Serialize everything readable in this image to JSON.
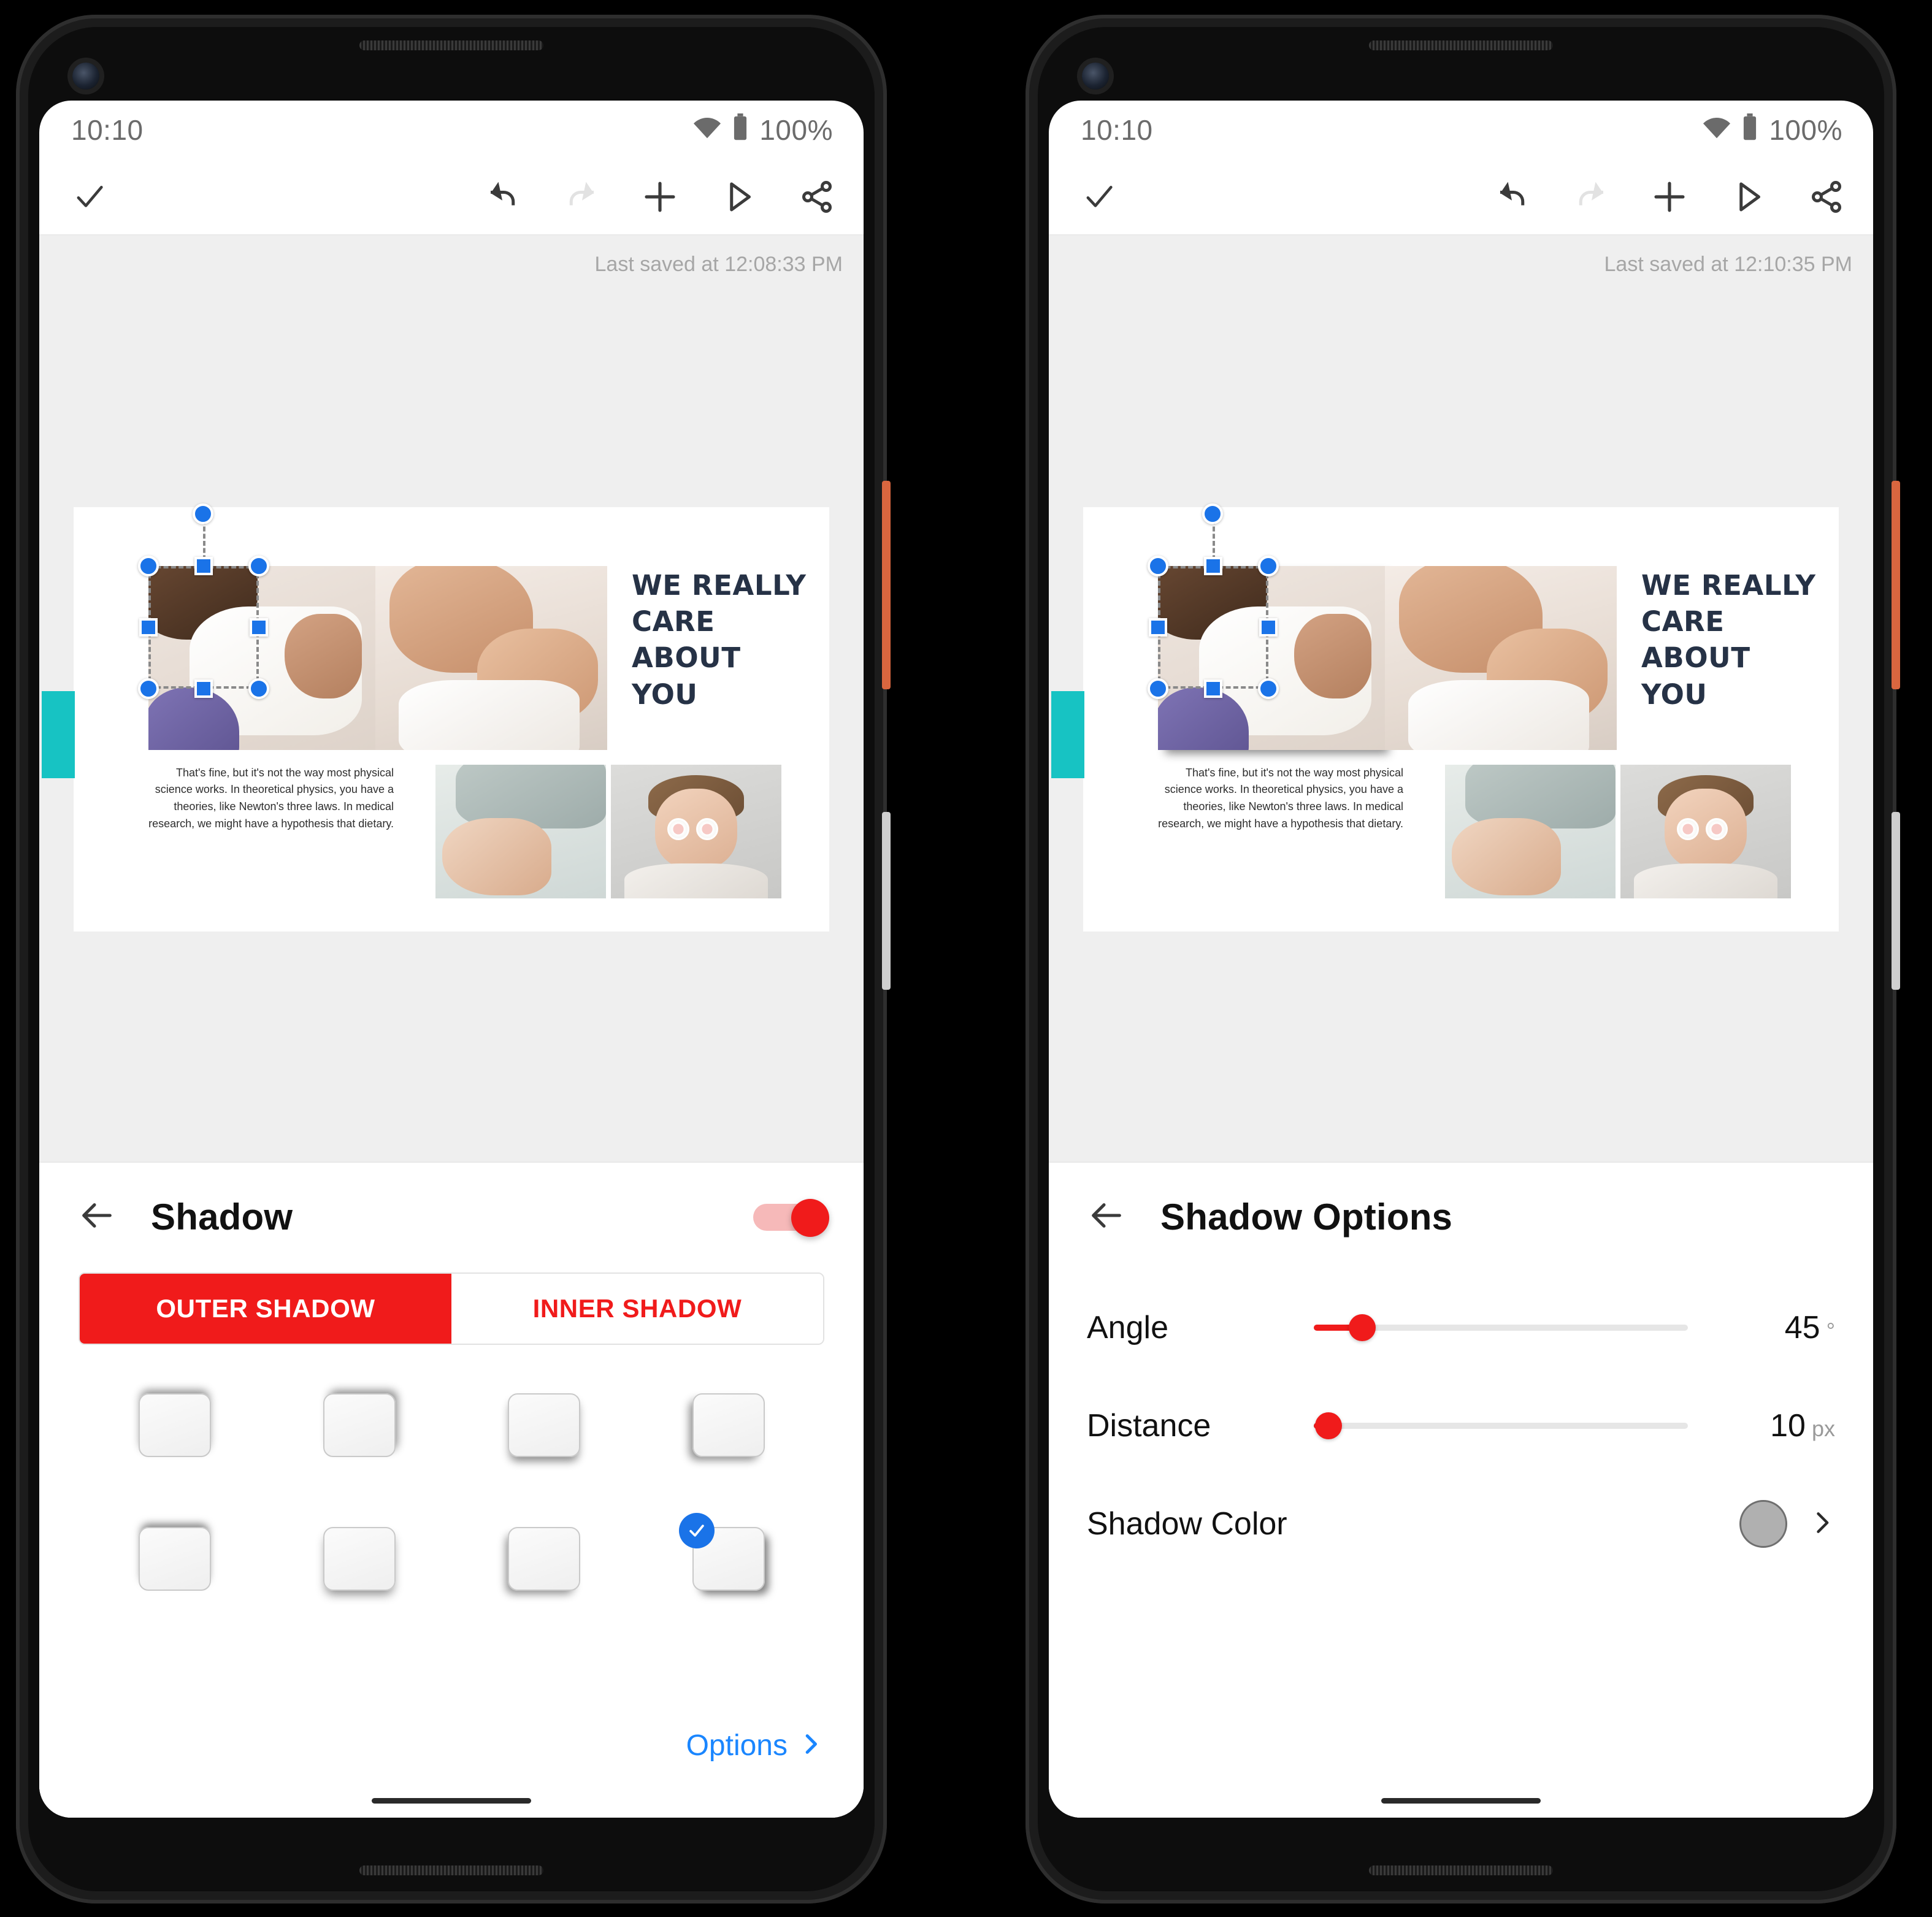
{
  "status": {
    "time": "10:10",
    "battery_pct": "100%",
    "wifi_icon": "wifi-icon",
    "battery_icon": "battery-icon"
  },
  "toolbar": {
    "done_icon": "check-icon",
    "undo_icon": "undo-icon",
    "redo_icon": "redo-icon",
    "add_icon": "plus-icon",
    "present_icon": "play-icon",
    "share_icon": "share-icon"
  },
  "left_phone": {
    "last_saved": "Last saved at 12:08:33 PM",
    "panel": {
      "back_icon": "arrow-left-icon",
      "title": "Shadow",
      "toggle_on": true,
      "segments": [
        {
          "label": "OUTER SHADOW",
          "active": true
        },
        {
          "label": "INNER SHADOW",
          "active": false
        }
      ],
      "presets": [
        {
          "id": "preset-1",
          "selected": false
        },
        {
          "id": "preset-2",
          "selected": false
        },
        {
          "id": "preset-3",
          "selected": false
        },
        {
          "id": "preset-4",
          "selected": false
        },
        {
          "id": "preset-5",
          "selected": false
        },
        {
          "id": "preset-6",
          "selected": false
        },
        {
          "id": "preset-7",
          "selected": false
        },
        {
          "id": "preset-8",
          "selected": true
        }
      ],
      "options_label": "Options",
      "options_chevron": "chevron-right-icon"
    }
  },
  "right_phone": {
    "last_saved": "Last saved at 12:10:35 PM",
    "panel": {
      "back_icon": "arrow-left-icon",
      "title": "Shadow Options",
      "rows": [
        {
          "label": "Angle",
          "value": "45",
          "unit": "°",
          "percent": 13
        },
        {
          "label": "Distance",
          "value": "10",
          "unit": "px",
          "percent": 4
        }
      ],
      "color_row": {
        "label": "Shadow Color",
        "swatch_hex": "#b0b0b0",
        "chevron": "chevron-right-icon"
      }
    }
  },
  "slide": {
    "headline": "WE REALLY CARE ABOUT YOU",
    "body": "That's fine, but it's not the way most physical science works. In theoretical physics, you have a theories, like Newton's three laws. In medical research, we might have a hypothesis that dietary.",
    "accent_hex": "#17c3c3",
    "headline_hex": "#263246",
    "images": [
      "massage-legs-photo",
      "massage-foot-photo",
      "bandaged-hand-photo",
      "woman-eyes-photo"
    ]
  },
  "colors": {
    "accent_red": "#f01b1b",
    "link_blue": "#1a86ff",
    "selection_blue": "#1a73e8",
    "power_button": "#d9663f",
    "volume_button": "#cfcfcf"
  }
}
